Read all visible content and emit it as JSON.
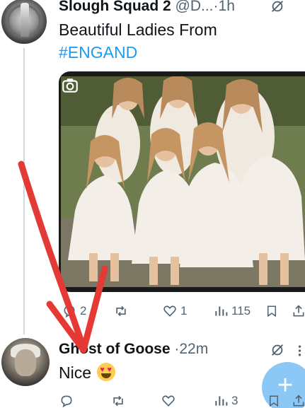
{
  "thread": {
    "post1": {
      "author_name": "Slough Squad 2",
      "handle": "@D...",
      "separator": "·",
      "time": "1h",
      "text": "Beautiful Ladies From",
      "hashtag": "#ENGAND",
      "media_icon": "camera-icon",
      "actions": {
        "reply_count": "2",
        "retweet_count": "",
        "like_count": "1",
        "views_count": "115"
      }
    },
    "post2": {
      "author_name": "Ghost of Goose",
      "separator": "·",
      "time": "22m",
      "text": "Nice",
      "emoji": "😍",
      "actions": {
        "reply_count": "",
        "retweet_count": "",
        "like_count": "",
        "views_count": "3"
      }
    }
  },
  "compose_button": {
    "label": "+"
  },
  "colors": {
    "link": "#1d9bf0",
    "muted": "#536471",
    "fab": "#8cc8f6",
    "annotation_arrow": "#e53935"
  }
}
